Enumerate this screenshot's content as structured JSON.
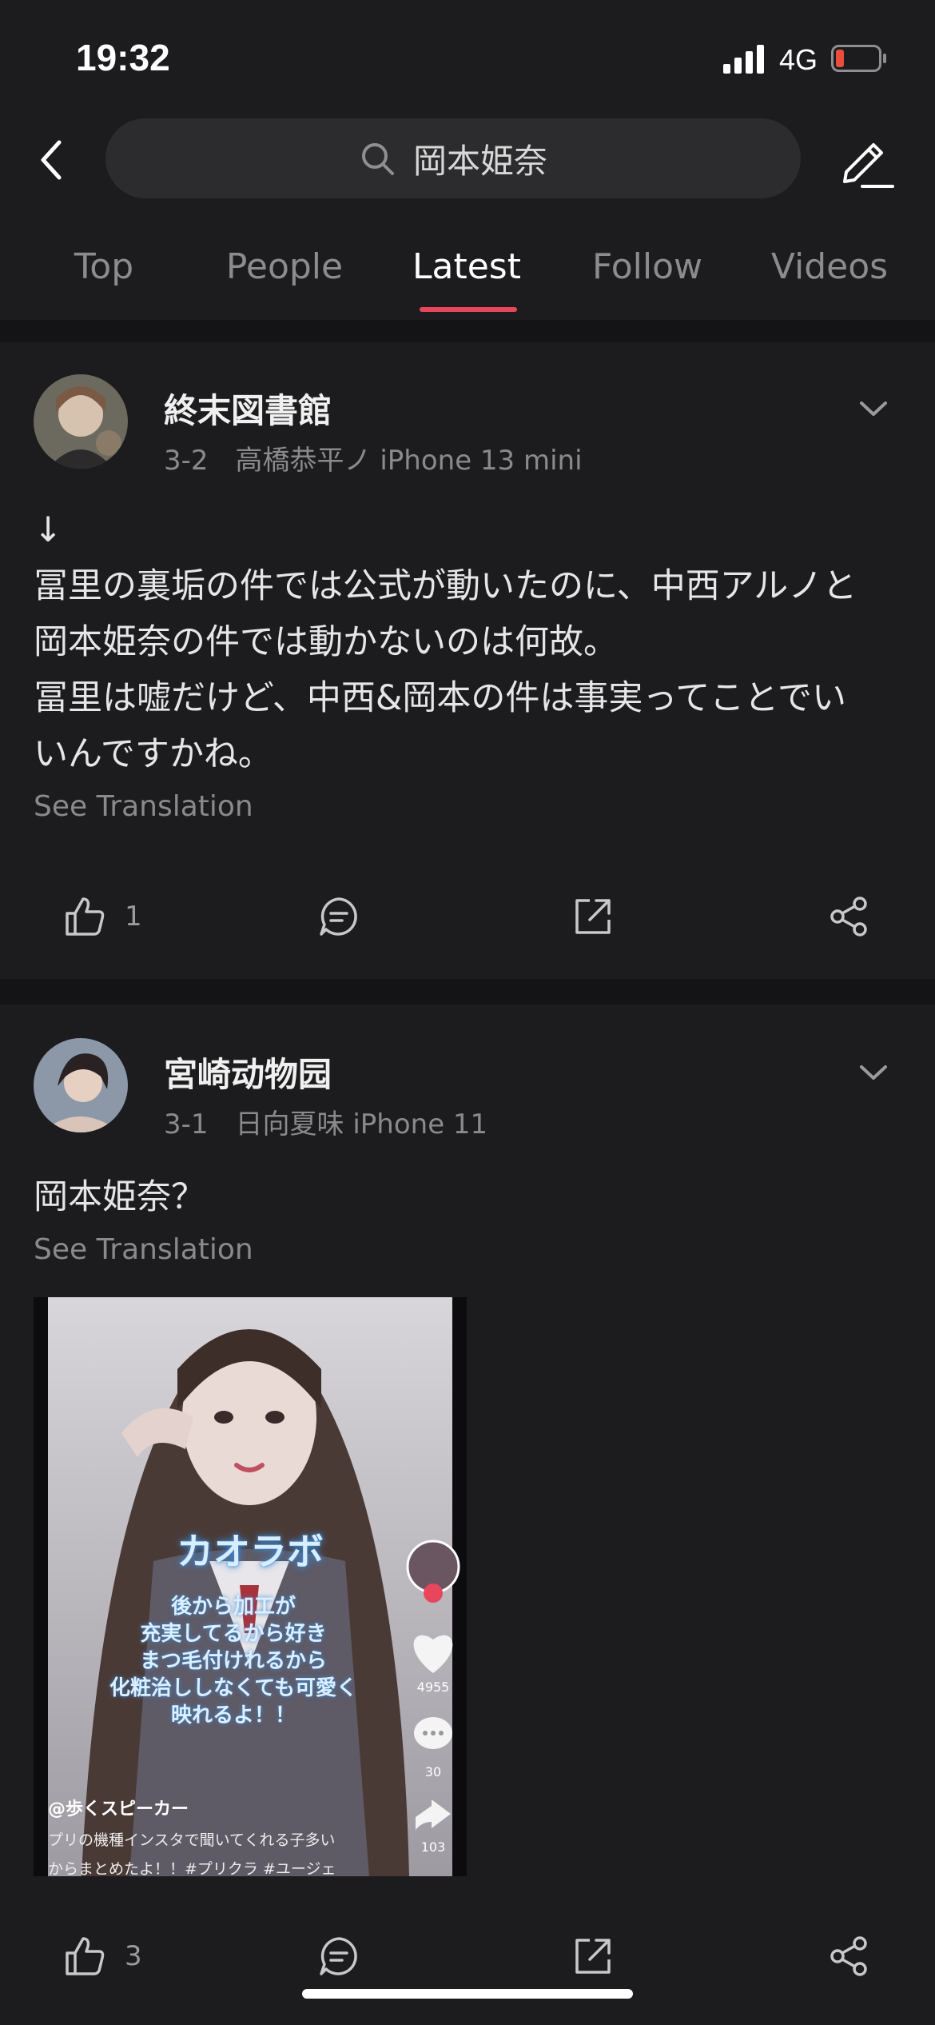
{
  "status": {
    "time": "19:32",
    "network": "4G"
  },
  "search": {
    "query": "岡本姫奈"
  },
  "tabs": [
    {
      "label": "Top",
      "active": false
    },
    {
      "label": "People",
      "active": false
    },
    {
      "label": "Latest",
      "active": true
    },
    {
      "label": "Follow",
      "active": false
    },
    {
      "label": "Videos",
      "active": false
    }
  ],
  "posts": [
    {
      "username": "終末図書館",
      "meta": "3-2　高橋恭平ノ iPhone 13 mini",
      "lines": [
        "↓",
        "冨里の裏垢の件では公式が動いたのに、中西アルノと",
        "岡本姫奈の件では動かないのは何故。",
        "冨里は嘘だけど、中西&岡本の件は事実ってことでい",
        "いんですかね。"
      ],
      "see_translation": "See Translation",
      "like_count": "1"
    },
    {
      "username": "宮崎动物园",
      "meta": "3-1　日向夏味 iPhone 11",
      "lines": [
        "岡本姫奈？"
      ],
      "see_translation": "See Translation",
      "like_count": "3",
      "image": {
        "title": "カオラボ",
        "caption_lines": [
          "後から加工が",
          "充実してるから好き",
          "まつ毛付けれるから",
          "化粧治ししなくても可愛く",
          "映れるよ！！"
        ],
        "likes": "4955",
        "comments": "30",
        "shares": "103",
        "author": "@歩くスピーカー",
        "desc_1": "プリの機種インスタで聞いてくれる子多い",
        "desc_2": "からまとめたよ！！#プリクラ #ユージェ"
      }
    }
  ],
  "colors": {
    "accent": "#e8465c",
    "background": "#1c1c1e",
    "separator": "#141416"
  }
}
